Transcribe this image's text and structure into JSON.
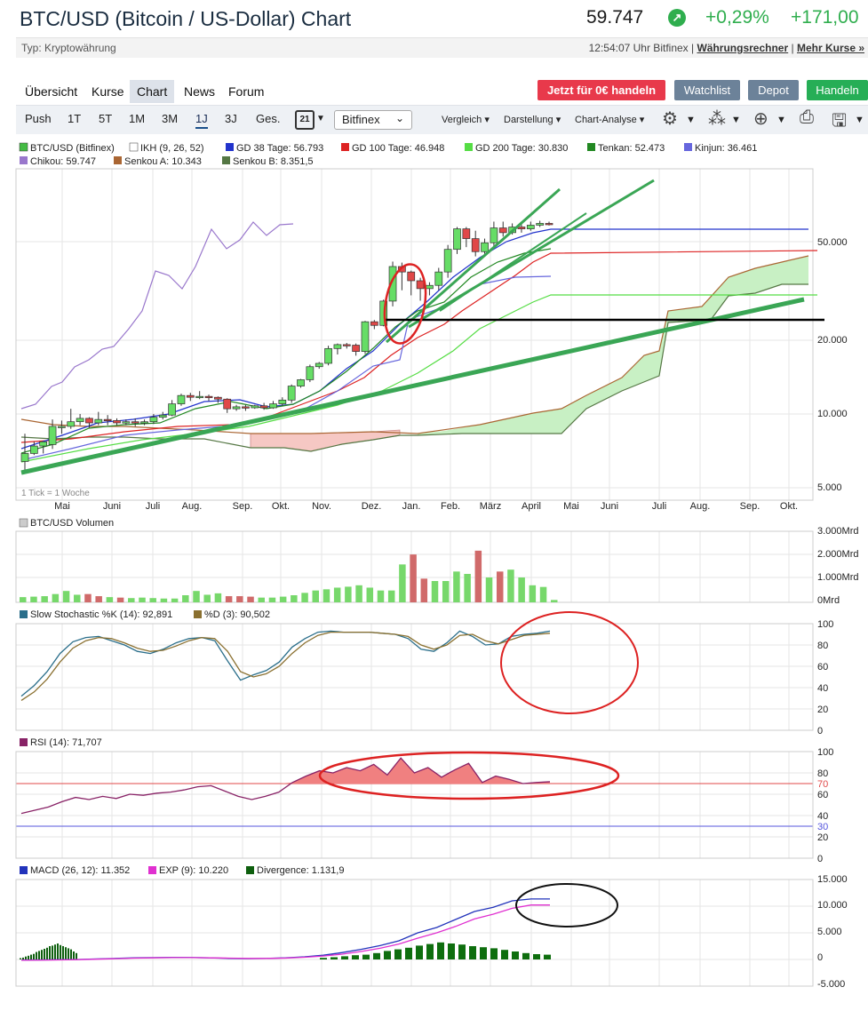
{
  "header": {
    "title": "BTC/USD (Bitcoin / US-Dollar) Chart",
    "price": "59.747",
    "change_pct": "+0,29%",
    "change_abs": "+171,00"
  },
  "subbar": {
    "type": "Typ: Kryptowährung",
    "time": "12:54:07 Uhr Bitfinex |",
    "link1": "Währungsrechner",
    "sep": "|",
    "link2": "Mehr Kurse »"
  },
  "tabs": [
    "Übersicht",
    "Kurse",
    "Chart",
    "News",
    "Forum"
  ],
  "buttons": {
    "trade_free": "Jetzt für 0€ handeln",
    "watchlist": "Watchlist",
    "depot": "Depot",
    "handeln": "Handeln"
  },
  "toolbar": {
    "ranges": [
      "Push",
      "1T",
      "5T",
      "1M",
      "3M",
      "1J",
      "3J",
      "Ges."
    ],
    "calendar_day": "21",
    "exchange": "Bitfinex",
    "vergleich": "Vergleich",
    "darstellung": "Darstellung",
    "chart_analyse": "Chart-Analyse"
  },
  "colors": {
    "up_green": "#2fae4e",
    "candle_up": "#66dd66",
    "candle_down": "#e04848",
    "trend_green": "#3aa655",
    "annotation_red": "#dd2222"
  },
  "chart_data": [
    {
      "type": "candlestick",
      "legend": [
        {
          "label": "BTC/USD (Bitfinex)",
          "color": "#44bb44"
        },
        {
          "label": "IKH (9, 26, 52)",
          "color": "#ffffff"
        },
        {
          "label": "GD 38 Tage: 56.793",
          "color": "#2233cc"
        },
        {
          "label": "GD 100 Tage: 46.948",
          "color": "#dd2222"
        },
        {
          "label": "GD 200 Tage: 30.830",
          "color": "#55dd44"
        },
        {
          "label": "Tenkan: 52.473",
          "color": "#228822"
        },
        {
          "label": "Kinjun: 36.461",
          "color": "#6666dd"
        },
        {
          "label": "Chikou: 59.747",
          "color": "#9977cc"
        },
        {
          "label": "Senkou A: 10.343",
          "color": "#aa6633"
        },
        {
          "label": "Senkou B: 8.351,5",
          "color": "#557744"
        }
      ],
      "y_scale": "log",
      "yticks": [
        "50.000",
        "20.000",
        "10.000",
        "5.000"
      ],
      "xticks": [
        "Mai",
        "Juni",
        "Juli",
        "Aug.",
        "Sep.",
        "Okt.",
        "Nov.",
        "Dez.",
        "Jan.",
        "Feb.",
        "März",
        "April",
        "Mai",
        "Juni",
        "Juli",
        "Aug.",
        "Sep.",
        "Okt."
      ],
      "note": "1 Tick = 1 Woche",
      "candles": [
        [
          6400,
          6900,
          5900,
          8300
        ],
        [
          6900,
          7400,
          6800,
          7700
        ],
        [
          7400,
          7700,
          6900,
          7500
        ],
        [
          7500,
          8900,
          7200,
          9500
        ],
        [
          8900,
          8900,
          8300,
          9400
        ],
        [
          8900,
          9300,
          8700,
          10500
        ],
        [
          9300,
          9600,
          9000,
          10000
        ],
        [
          9600,
          9200,
          8800,
          9700
        ],
        [
          9200,
          9500,
          9000,
          10200
        ],
        [
          9500,
          9400,
          9000,
          9900
        ],
        [
          9400,
          9200,
          9000,
          9600
        ],
        [
          9200,
          9300,
          9000,
          9500
        ],
        [
          9300,
          9200,
          8900,
          9600
        ],
        [
          9200,
          9300,
          9000,
          9500
        ],
        [
          9300,
          9700,
          9100,
          10000
        ],
        [
          9700,
          9900,
          9500,
          10200
        ],
        [
          9900,
          11000,
          9800,
          11400
        ],
        [
          11000,
          11900,
          10800,
          12100
        ],
        [
          11900,
          11700,
          11300,
          12200
        ],
        [
          11700,
          11800,
          11500,
          12400
        ],
        [
          11800,
          11700,
          11300,
          12000
        ],
        [
          11700,
          11500,
          11100,
          11800
        ],
        [
          11500,
          10500,
          10100,
          11600
        ],
        [
          10500,
          10700,
          10300,
          10900
        ],
        [
          10700,
          10600,
          10300,
          10900
        ],
        [
          10600,
          10800,
          10500,
          10900
        ],
        [
          10800,
          10600,
          10400,
          11100
        ],
        [
          10600,
          11000,
          10500,
          11300
        ],
        [
          11000,
          11400,
          10800,
          11700
        ],
        [
          11400,
          13000,
          11100,
          13200
        ],
        [
          13000,
          13800,
          12800,
          13900
        ],
        [
          13800,
          15600,
          13500,
          15900
        ],
        [
          15600,
          16100,
          15300,
          16300
        ],
        [
          16100,
          18500,
          15800,
          19000
        ],
        [
          18500,
          19200,
          17500,
          19400
        ],
        [
          19200,
          19100,
          18500,
          19500
        ],
        [
          19100,
          18000,
          17300,
          19400
        ],
        [
          18000,
          23800,
          17600,
          24000
        ],
        [
          23800,
          23000,
          22200,
          24200
        ],
        [
          23000,
          28900,
          22800,
          29300
        ],
        [
          28900,
          40000,
          27500,
          41900
        ],
        [
          40000,
          38000,
          32000,
          41500
        ],
        [
          38000,
          35000,
          30500,
          38500
        ],
        [
          35000,
          32500,
          29000,
          36000
        ],
        [
          32500,
          33500,
          30500,
          34500
        ],
        [
          33500,
          38000,
          32000,
          39500
        ],
        [
          38000,
          47000,
          36000,
          49000
        ],
        [
          47000,
          57000,
          45000,
          58000
        ],
        [
          57000,
          52000,
          48000,
          58000
        ],
        [
          52000,
          46000,
          44000,
          56000
        ],
        [
          46000,
          50000,
          45000,
          52000
        ],
        [
          50000,
          57500,
          48000,
          61000
        ],
        [
          57500,
          55000,
          53000,
          61000
        ],
        [
          55000,
          58000,
          54000,
          60000
        ],
        [
          58000,
          57000,
          55000,
          60000
        ],
        [
          57000,
          59000,
          56000,
          61000
        ],
        [
          59000,
          60000,
          58000,
          61500
        ],
        [
          60000,
          59747,
          58800,
          61000
        ]
      ],
      "levels": {
        "gd38_last": 56793,
        "gd100_last": 46948,
        "gd200_last": 30830,
        "kinjun_last": 36461,
        "resistance": 22000
      }
    },
    {
      "type": "bar",
      "title": "BTC/USD Volumen",
      "yticks": [
        "3.000Mrd",
        "2.000Mrd",
        "1.000Mrd",
        "0Mrd"
      ],
      "values": [
        0.22,
        0.24,
        0.26,
        0.35,
        0.48,
        0.32,
        0.35,
        0.26,
        0.22,
        0.2,
        0.18,
        0.2,
        0.18,
        0.16,
        0.16,
        0.3,
        0.48,
        0.32,
        0.38,
        0.26,
        0.26,
        0.24,
        0.2,
        0.2,
        0.24,
        0.3,
        0.4,
        0.5,
        0.55,
        0.62,
        0.66,
        0.72,
        0.62,
        0.5,
        0.5,
        1.6,
        2.02,
        1.0,
        0.9,
        0.9,
        1.3,
        1.2,
        2.18,
        1.05,
        1.3,
        1.38,
        1.05,
        0.72,
        0.65,
        0.1
      ],
      "down": [
        6,
        7,
        9,
        19,
        20,
        21,
        36,
        37,
        42,
        44
      ]
    },
    {
      "type": "line",
      "title": "Slow Stochastic %K (14): 92,891",
      "title2": "%D (3): 90,502",
      "yticks": [
        "100",
        "80",
        "60",
        "40",
        "20",
        "0"
      ],
      "series": [
        {
          "name": "Slow Stochastic %K (14): 92,891",
          "color": "#2a6e8a",
          "values": [
            32,
            42,
            55,
            72,
            83,
            87,
            88,
            84,
            80,
            74,
            72,
            76,
            82,
            86,
            87,
            84,
            65,
            47,
            52,
            56,
            64,
            78,
            86,
            92,
            93,
            92,
            92,
            92,
            91,
            90,
            86,
            76,
            74,
            82,
            93,
            88,
            80,
            81,
            88,
            90,
            91,
            93
          ]
        },
        {
          "name": "%D (3): 90,502",
          "color": "#8a7030",
          "values": [
            28,
            36,
            48,
            64,
            77,
            84,
            87,
            86,
            82,
            77,
            74,
            75,
            79,
            84,
            87,
            86,
            74,
            55,
            50,
            53,
            60,
            72,
            82,
            89,
            92,
            92,
            92,
            92,
            91,
            90,
            88,
            80,
            76,
            80,
            89,
            90,
            84,
            81,
            85,
            89,
            90,
            91
          ]
        }
      ]
    },
    {
      "type": "area",
      "title": "RSI (14): 71,707",
      "yticks": [
        "100",
        "80",
        "60",
        "40",
        "20",
        "0"
      ],
      "levels": [
        70,
        30
      ],
      "values": [
        42,
        45,
        48,
        53,
        57,
        55,
        58,
        56,
        60,
        59,
        61,
        62,
        64,
        67,
        68,
        63,
        58,
        55,
        58,
        62,
        71,
        77,
        82,
        80,
        85,
        82,
        88,
        78,
        94,
        80,
        85,
        76,
        83,
        89,
        71,
        77,
        74,
        70,
        71,
        71.7
      ]
    },
    {
      "type": "line",
      "title": "MACD (26, 12): 11.352",
      "title2": "EXP (9): 10.220",
      "title3": "Divergence: 1.131,9",
      "yticks": [
        "15.000",
        "10.000",
        "5.000",
        "0",
        "-5.000"
      ],
      "series": [
        {
          "name": "MACD (26, 12): 11.352",
          "color": "#2233bb",
          "values": [
            -100,
            -80,
            -50,
            0,
            100,
            200,
            300,
            350,
            400,
            380,
            300,
            200,
            150,
            200,
            300,
            500,
            800,
            1300,
            1900,
            2600,
            3500,
            5000,
            6000,
            7500,
            9000,
            9800,
            11000,
            11352,
            11352
          ]
        },
        {
          "name": "EXP (9): 10.220",
          "color": "#e030d0",
          "values": [
            -150,
            -120,
            -80,
            -30,
            50,
            150,
            250,
            300,
            350,
            350,
            300,
            250,
            200,
            200,
            260,
            420,
            650,
            1000,
            1500,
            2100,
            2900,
            4000,
            5000,
            6200,
            7600,
            8500,
            9600,
            10220,
            10220
          ]
        }
      ],
      "divergence": [
        250,
        350,
        550,
        700,
        900,
        1050,
        1400,
        1600,
        1800,
        2000,
        2200,
        2500,
        2600,
        2800,
        3000,
        2700,
        2500,
        2300,
        2100,
        1900,
        1500,
        1200
      ]
    }
  ]
}
